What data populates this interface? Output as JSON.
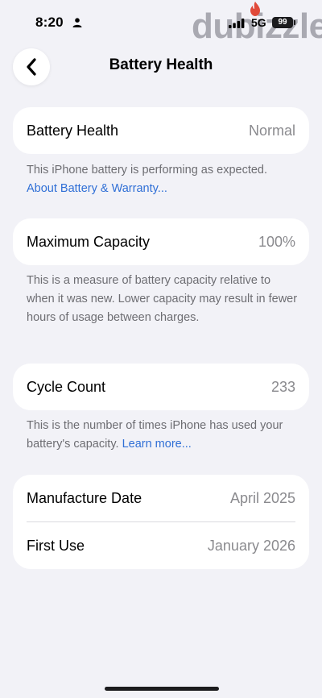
{
  "status_bar": {
    "time": "8:20",
    "network": "5G",
    "battery": "99"
  },
  "watermark": {
    "text": "dubizzle",
    "flame_color": "#e04a3a"
  },
  "header": {
    "title": "Battery Health",
    "back_icon": "chevron-left-icon"
  },
  "battery_health": {
    "label": "Battery Health",
    "value": "Normal",
    "note": "This iPhone battery is performing as expected.",
    "link": "About Battery & Warranty..."
  },
  "maximum_capacity": {
    "label": "Maximum Capacity",
    "value": "100%",
    "note": "This is a measure of battery capacity relative to when it was new. Lower capacity may result in fewer hours of usage between charges."
  },
  "cycle_count": {
    "label": "Cycle Count",
    "value": "233",
    "note": "This is the number of times iPhone has used your battery's capacity.",
    "link": "Learn more..."
  },
  "dates": {
    "manufacture_label": "Manufacture Date",
    "manufacture_value": "April 2025",
    "first_use_label": "First Use",
    "first_use_value": "January 2026"
  },
  "colors": {
    "background": "#f2f2f7",
    "link": "#2f6fd6"
  }
}
